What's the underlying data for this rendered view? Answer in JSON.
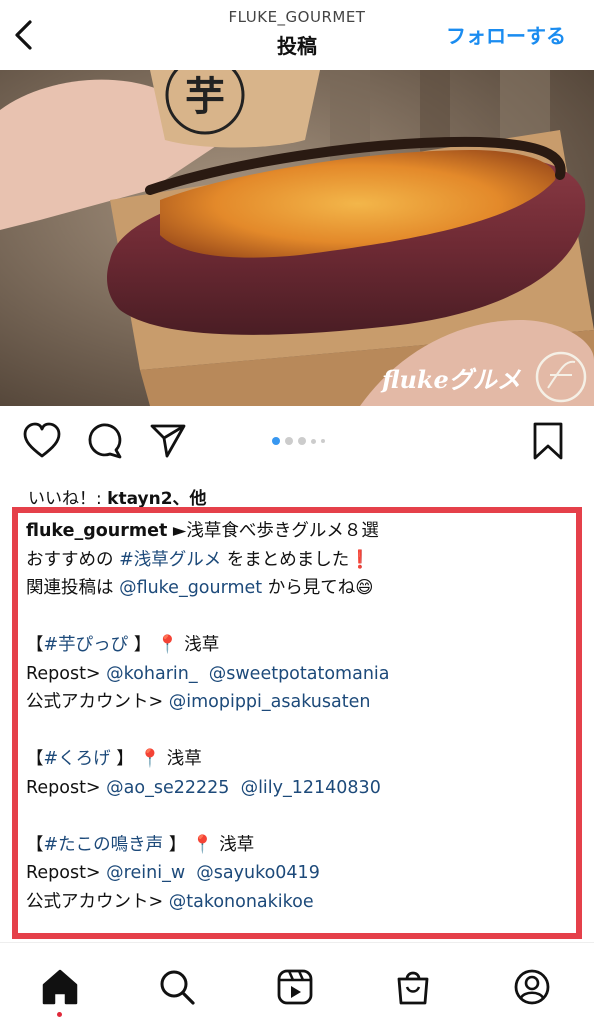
{
  "header": {
    "username": "FLUKE_GOURMET",
    "title": "投稿",
    "follow_label": "フォローする",
    "back_icon": "chevron-left-icon"
  },
  "photo": {
    "watermark": "flukeグルメ",
    "cup_mark": "芋"
  },
  "actions": {
    "icons": [
      "heart-icon",
      "comment-icon",
      "share-icon",
      "bookmark-icon"
    ],
    "carousel_total": 5,
    "carousel_active": 1
  },
  "likes": {
    "prefix": "いいね！: ",
    "user": "ktayn2",
    "suffix": "、他"
  },
  "caption": {
    "l1_user": "fluke_gourmet",
    "l1_text": " ►浅草食べ歩きグルメ８選",
    "l2_a": "おすすめの ",
    "l2_tag": "#浅草グルメ",
    "l2_b": " をまとめました",
    "l2_emoji": "❗",
    "l3_a": "関連投稿は ",
    "l3_mention": "@fluke_gourmet",
    "l3_b": " から見てね",
    "l3_emoji": "😄",
    "s1_open": "【",
    "s1_tag": "#芋ぴっぴ",
    "s1_close": " 】",
    "s1_pin": "📍",
    "s1_place": " 浅草",
    "s1_repost_label": "Repost> ",
    "s1_m1": "@koharin_",
    "s1_m2": "@sweetpotatomania",
    "s1_official_label": "公式アカウント> ",
    "s1_official": "@imopippi_asakusaten",
    "s2_open": "【",
    "s2_tag": "#くろげ",
    "s2_close": " 】",
    "s2_pin": "📍",
    "s2_place": " 浅草",
    "s2_repost_label": "Repost> ",
    "s2_m1": "@ao_se22225",
    "s2_m2": "@lily_12140830",
    "s3_open": "【",
    "s3_tag": "#たこの鳴き声",
    "s3_close": " 】",
    "s3_pin": "📍",
    "s3_place": " 浅草",
    "s3_repost_label": "Repost> ",
    "s3_m1": "@reini_w",
    "s3_m2": "@sayuko0419",
    "s3_official_label": "公式アカウント> ",
    "s3_official": "@takononakikoe"
  },
  "nav": {
    "icons": [
      "home-icon",
      "search-icon",
      "reels-icon",
      "shop-icon",
      "profile-icon"
    ]
  },
  "colors": {
    "follow": "#1a8cf0",
    "mention": "#1d4a7a",
    "highlight_border": "#e5404a",
    "active_dot": "#3897f0"
  }
}
